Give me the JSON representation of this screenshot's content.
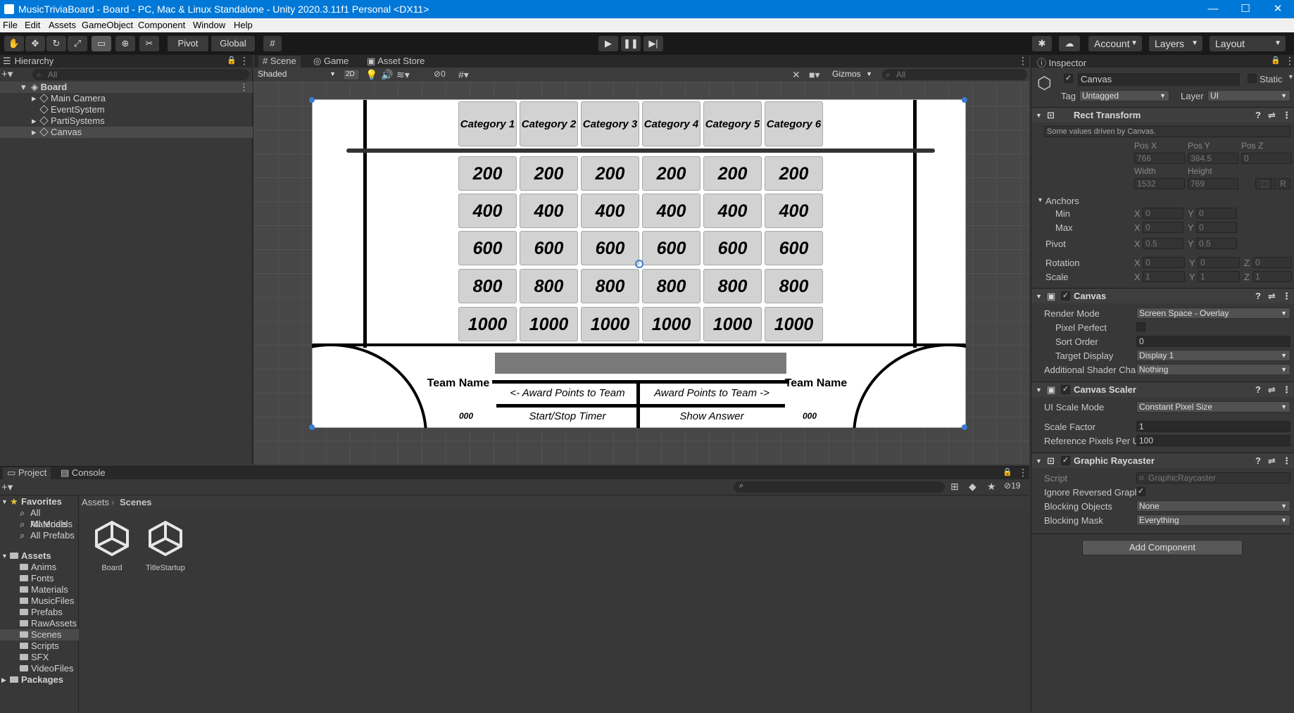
{
  "titlebar": {
    "title": "MusicTriviaBoard - Board - PC, Mac & Linux Standalone - Unity 2020.3.11f1 Personal <DX11>",
    "minimize": "—",
    "maximize": "☐",
    "close": "✕"
  },
  "menu": [
    "File",
    "Edit",
    "Assets",
    "GameObject",
    "Component",
    "Window",
    "Help"
  ],
  "toolbar": {
    "pivot": "Pivot",
    "global": "Global",
    "account": "Account",
    "layers": "Layers",
    "layout": "Layout"
  },
  "hierarchy": {
    "tab": "Hierarchy",
    "search_placeholder": "All",
    "scene": "Board",
    "items": [
      "Main Camera",
      "EventSystem",
      "PartiSystems",
      "Canvas"
    ]
  },
  "scene_view": {
    "tabs": [
      "Scene",
      "Game",
      "Asset Store"
    ],
    "shading": "Shaded",
    "mode_2d": "2D",
    "hidden_count": "0",
    "gizmos": "Gizmos",
    "search_placeholder": "All"
  },
  "board": {
    "categories": [
      "Category 1",
      "Category 2",
      "Category 3",
      "Category 4",
      "Category 5",
      "Category 6"
    ],
    "values": [
      "200",
      "400",
      "600",
      "800",
      "1000"
    ],
    "team_left": "Team Name",
    "team_right": "Team Name",
    "score_left": "000",
    "score_right": "000",
    "award_left": "<- Award Points to Team",
    "award_right": "Award Points to Team ->",
    "start_stop": "Start/Stop Timer",
    "show_answer": "Show Answer"
  },
  "inspector": {
    "tab": "Inspector",
    "object_name": "Canvas",
    "static_label": "Static",
    "tag_label": "Tag",
    "tag_value": "Untagged",
    "layer_label": "Layer",
    "layer_value": "UI",
    "rect_transform": {
      "title": "Rect Transform",
      "note": "Some values driven by Canvas.",
      "posx_label": "Pos X",
      "posy_label": "Pos Y",
      "posz_label": "Pos Z",
      "posx": "766",
      "posy": "384.5",
      "posz": "0",
      "width_label": "Width",
      "height_label": "Height",
      "width": "1532",
      "height": "769",
      "r_button": "R",
      "anchors": "Anchors",
      "min": "Min",
      "max": "Max",
      "min_x": "0",
      "min_y": "0",
      "max_x": "0",
      "max_y": "0",
      "pivot": "Pivot",
      "pivot_x": "0.5",
      "pivot_y": "0.5",
      "rotation": "Rotation",
      "rot_x": "0",
      "rot_y": "0",
      "rot_z": "0",
      "scale": "Scale",
      "scale_x": "1",
      "scale_y": "1",
      "scale_z": "1",
      "x": "X",
      "y": "Y",
      "z": "Z"
    },
    "canvas": {
      "title": "Canvas",
      "render_mode_label": "Render Mode",
      "render_mode": "Screen Space - Overlay",
      "pixel_perfect": "Pixel Perfect",
      "sort_order_label": "Sort Order",
      "sort_order": "0",
      "target_display_label": "Target Display",
      "target_display": "Display 1",
      "shader_label": "Additional Shader Chai",
      "shader_value": "Nothing"
    },
    "canvas_scaler": {
      "title": "Canvas Scaler",
      "ui_scale_label": "UI Scale Mode",
      "ui_scale": "Constant Pixel Size",
      "scale_factor_label": "Scale Factor",
      "scale_factor": "1",
      "ref_pixels_label": "Reference Pixels Per U",
      "ref_pixels": "100"
    },
    "graphic_raycaster": {
      "title": "Graphic Raycaster",
      "script_label": "Script",
      "script": "GraphicRaycaster",
      "ignore_label": "Ignore Reversed Graph",
      "blocking_objects_label": "Blocking Objects",
      "blocking_objects": "None",
      "blocking_mask_label": "Blocking Mask",
      "blocking_mask": "Everything"
    },
    "add_component": "Add Component"
  },
  "project": {
    "tabs": [
      "Project",
      "Console"
    ],
    "hidden_count": "19",
    "favorites": "Favorites",
    "fav_items": [
      "All Materials",
      "All Models",
      "All Prefabs"
    ],
    "assets": "Assets",
    "folders": [
      "Anims",
      "Fonts",
      "Materials",
      "MusicFiles",
      "Prefabs",
      "RawAssets",
      "Scenes",
      "Scripts",
      "SFX",
      "VideoFiles"
    ],
    "packages": "Packages",
    "breadcrumb": [
      "Assets",
      "Scenes"
    ],
    "files": [
      "Board",
      "TitleStartup"
    ]
  }
}
